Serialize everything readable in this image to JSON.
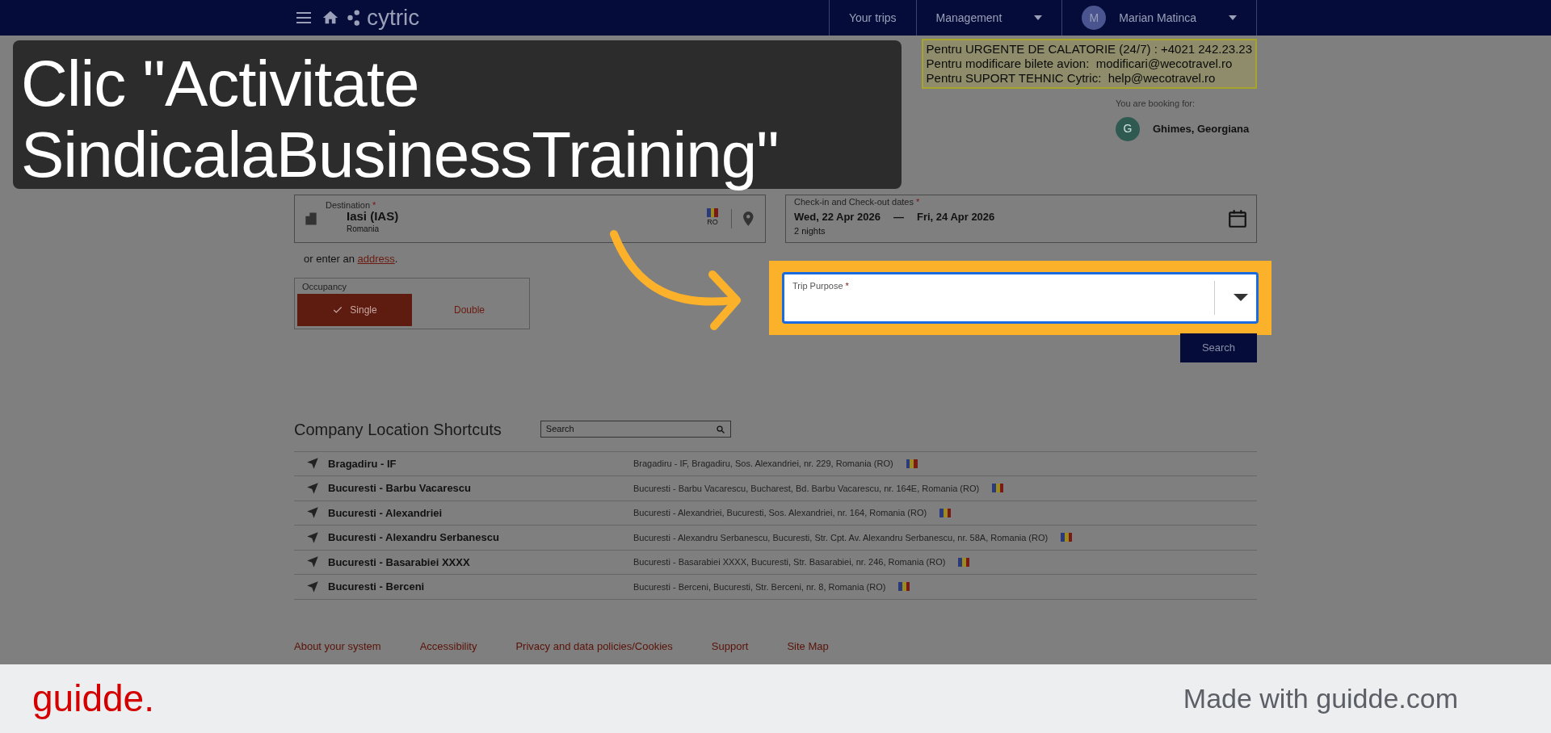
{
  "navbar": {
    "logo": "cytric",
    "links": [
      {
        "label": "Your trips",
        "dropdown": false
      },
      {
        "label": "Management",
        "dropdown": true
      }
    ],
    "user": {
      "initial": "M",
      "name": "Marian Matinca",
      "dropdown": true
    }
  },
  "contact_box": [
    "Pentru URGENTE DE CALATORIE (24/7) : +4021 242.23.23",
    "Pentru modificare bilete avion:  modificari@wecotravel.ro",
    "Pentru SUPORT TEHNIC Cytric:  help@wecotravel.ro"
  ],
  "booking_for": {
    "label": "You are booking for:",
    "initial": "G",
    "name": "Ghimes, Georgiana"
  },
  "required_mark": "*",
  "destination": {
    "label": "Destination",
    "required": true,
    "value": "Iasi (IAS)",
    "country": "Romania",
    "country_code": "RO"
  },
  "dates": {
    "label": "Check-in and Check-out dates",
    "required": true,
    "check_in": "Wed, 22 Apr 2026",
    "separator": "—",
    "check_out": "Fri, 24 Apr 2026",
    "nights": "2 nights"
  },
  "address_hint": {
    "text": "or enter an",
    "link": "address",
    "end": "."
  },
  "occupancy": {
    "label": "Occupancy",
    "options": [
      {
        "label": "Single",
        "selected": true
      },
      {
        "label": "Double",
        "selected": false
      }
    ]
  },
  "trip_purpose": {
    "label": "Trip Purpose",
    "required": true,
    "highlighted": true
  },
  "search_button": "Search",
  "shortcuts": {
    "title": "Company Location Shortcuts",
    "search_placeholder": "Search",
    "rows": [
      {
        "name": "Bragadiru - IF",
        "address": "Bragadiru - IF, Bragadiru, Sos. Alexandriei, nr. 229, Romania (RO)"
      },
      {
        "name": "Bucuresti - Barbu Vacarescu",
        "address": "Bucuresti - Barbu Vacarescu, Bucharest, Bd. Barbu Vacarescu, nr. 164E, Romania (RO)"
      },
      {
        "name": "Bucuresti - Alexandriei",
        "address": "Bucuresti - Alexandriei, Bucuresti, Sos. Alexandriei, nr. 164, Romania (RO)"
      },
      {
        "name": "Bucuresti - Alexandru Serbanescu",
        "address": "Bucuresti - Alexandru Serbanescu, Bucuresti, Str. Cpt. Av. Alexandru Serbanescu, nr. 58A, Romania (RO)"
      },
      {
        "name": "Bucuresti - Basarabiei XXXX",
        "address": "Bucuresti - Basarabiei XXXX, Bucuresti, Str. Basarabiei, nr. 246, Romania (RO)"
      },
      {
        "name": "Bucuresti - Berceni",
        "address": "Bucuresti - Berceni, Bucuresti, Str. Berceni, nr. 8, Romania (RO)"
      }
    ]
  },
  "footer_links": [
    "About your system",
    "Accessibility",
    "Privacy and data policies/Cookies",
    "Support",
    "Site Map"
  ],
  "caption": "Clic \"Activitate SindicalaBusinessTraining\"",
  "branding": {
    "logo": "guidde.",
    "note": "Made with guidde.com"
  }
}
